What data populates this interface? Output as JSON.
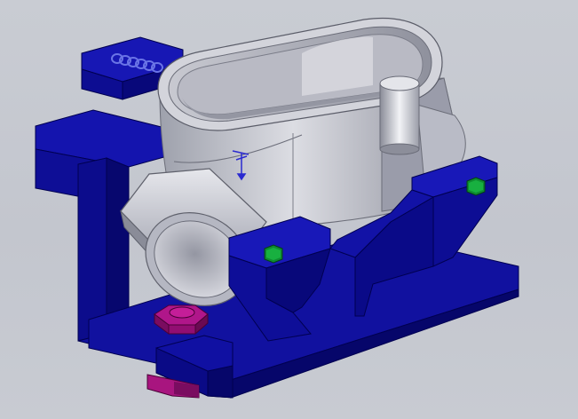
{
  "viewport": {
    "background": "#c6c9d0",
    "colors": {
      "fixture_blue": "#1010a0",
      "fixture_blue_dark": "#06066a",
      "fixture_blue_light": "#2a2ac8",
      "part_silver": "#c9cad2",
      "part_shadow": "#7e808c",
      "bolt_green": "#12a03a",
      "nut_magenta": "#a0147a",
      "spring_blue": "#5a66d8"
    },
    "icons": [
      "triad-axis-icon"
    ]
  }
}
